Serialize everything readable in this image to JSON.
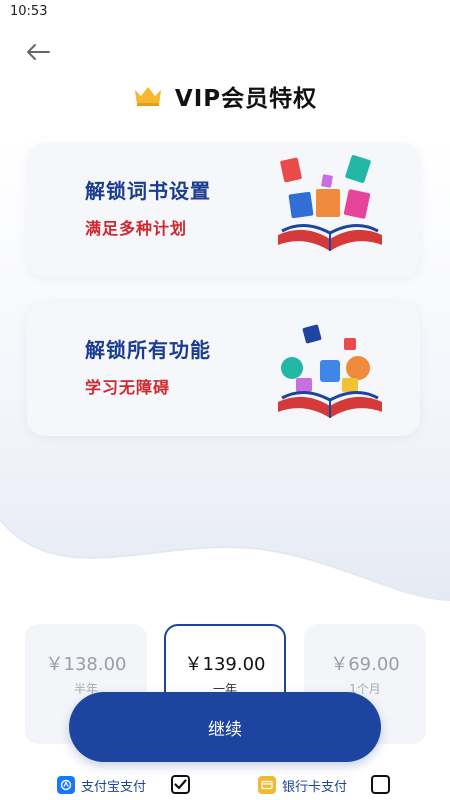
{
  "status_bar": {
    "time": "10:53"
  },
  "header": {
    "title": "VIP会员特权"
  },
  "features": [
    {
      "title": "解锁词书设置",
      "subtitle": "满足多种计划"
    },
    {
      "title": "解锁所有功能",
      "subtitle": "学习无障碍"
    }
  ],
  "plans": [
    {
      "price": "￥138.00",
      "period": "半年",
      "selected": false
    },
    {
      "price": "￥139.00",
      "period": "一年",
      "selected": true
    },
    {
      "price": "￥69.00",
      "period": "1个月",
      "selected": false
    }
  ],
  "continue_label": "继续",
  "payment": {
    "alipay": {
      "label": "支付宝支付",
      "checked": true
    },
    "bank": {
      "label": "银行卡支付",
      "checked": false
    }
  },
  "colors": {
    "primary": "#1d45a0",
    "feature_title": "#1b3c8f",
    "feature_sub": "#d0282e",
    "crown": "#f5b82e",
    "alipay": "#1677ff",
    "bank": "#f5b82e"
  }
}
